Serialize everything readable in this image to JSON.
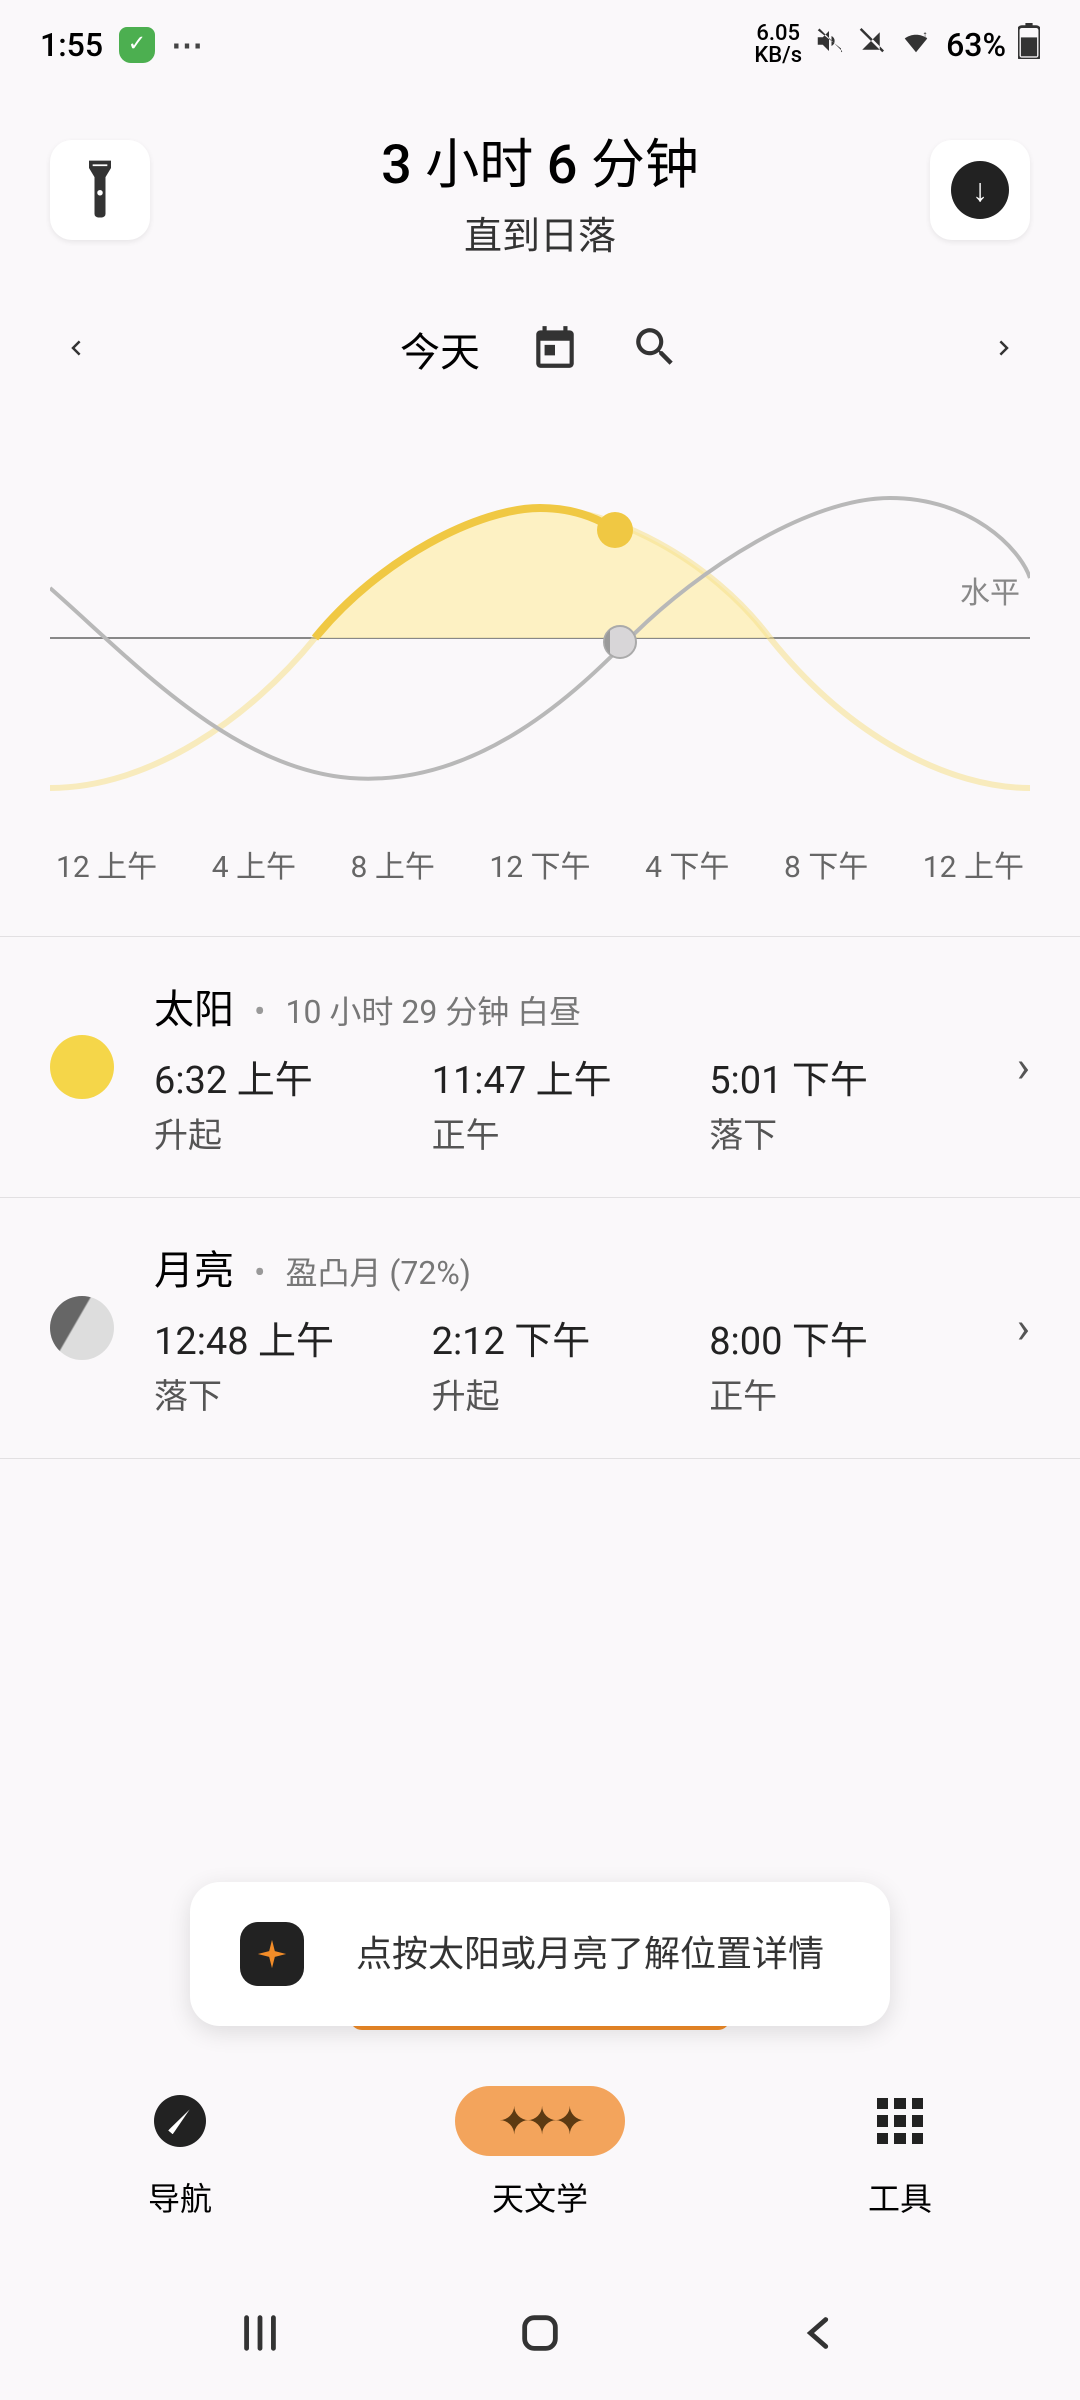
{
  "status": {
    "time": "1:55",
    "netspeed_top": "6.05",
    "netspeed_bot": "KB/s",
    "battery": "63%"
  },
  "header": {
    "countdown": "3 小时 6 分钟",
    "until": "直到日落"
  },
  "dateNav": {
    "today": "今天"
  },
  "chart": {
    "horizon": "水平",
    "xlabels": [
      "12 上午",
      "4 上午",
      "8 上午",
      "12 下午",
      "4 下午",
      "8 下午",
      "12 上午"
    ]
  },
  "sun": {
    "name": "太阳",
    "meta": "10 小时 29 分钟 白昼",
    "t1": "6:32 上午",
    "l1": "升起",
    "t2": "11:47 上午",
    "l2": "正午",
    "t3": "5:01 下午",
    "l3": "落下"
  },
  "moon": {
    "name": "月亮",
    "meta": "盈凸月 (72%)",
    "t1": "12:48 上午",
    "l1": "落下",
    "t2": "2:12 下午",
    "l2": "升起",
    "t3": "8:00 下午",
    "l3": "正午"
  },
  "hint": "点按太阳或月亮了解位置详情",
  "nav": {
    "n1": "导航",
    "n2": "天文学",
    "n3": "工具"
  },
  "chart_data": {
    "type": "line",
    "x_hours": [
      0,
      2,
      4,
      6,
      8,
      10,
      12,
      14,
      16,
      18,
      20,
      22,
      24
    ],
    "series": [
      {
        "name": "sun_altitude",
        "values": [
          -55,
          -50,
          -30,
          -5,
          20,
          40,
          45,
          40,
          20,
          -5,
          -30,
          -50,
          -55
        ],
        "color": "#f5d649"
      },
      {
        "name": "moon_altitude",
        "values": [
          15,
          -5,
          -25,
          -40,
          -45,
          -40,
          -25,
          -5,
          15,
          35,
          48,
          40,
          20
        ],
        "color": "#999999"
      }
    ],
    "horizon_y": 0,
    "ylim": [
      -60,
      60
    ],
    "current_hour": 13.9,
    "markers": {
      "sun": {
        "x_hour": 13.9,
        "y": 36
      },
      "moon": {
        "x_hour": 13.9,
        "y": -2
      }
    }
  }
}
